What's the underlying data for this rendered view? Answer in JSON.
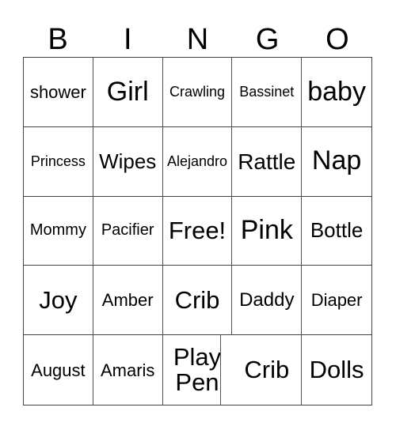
{
  "title_letters": [
    "B",
    "I",
    "N",
    "G",
    "O"
  ],
  "cells": [
    [
      "shower",
      "Girl",
      "Crawling",
      "Bassinet",
      "baby"
    ],
    [
      "Princess",
      "Wipes",
      "Alejandro",
      "Rattle",
      "Nap"
    ],
    [
      "Mommy",
      "Pacifier",
      "Free!",
      "Pink",
      "Bottle"
    ],
    [
      "Joy",
      "Amber",
      "Crib",
      "Daddy",
      "Diaper"
    ],
    [
      "August",
      "Amaris",
      "Play Pen",
      "Crib",
      "Dolls"
    ]
  ]
}
